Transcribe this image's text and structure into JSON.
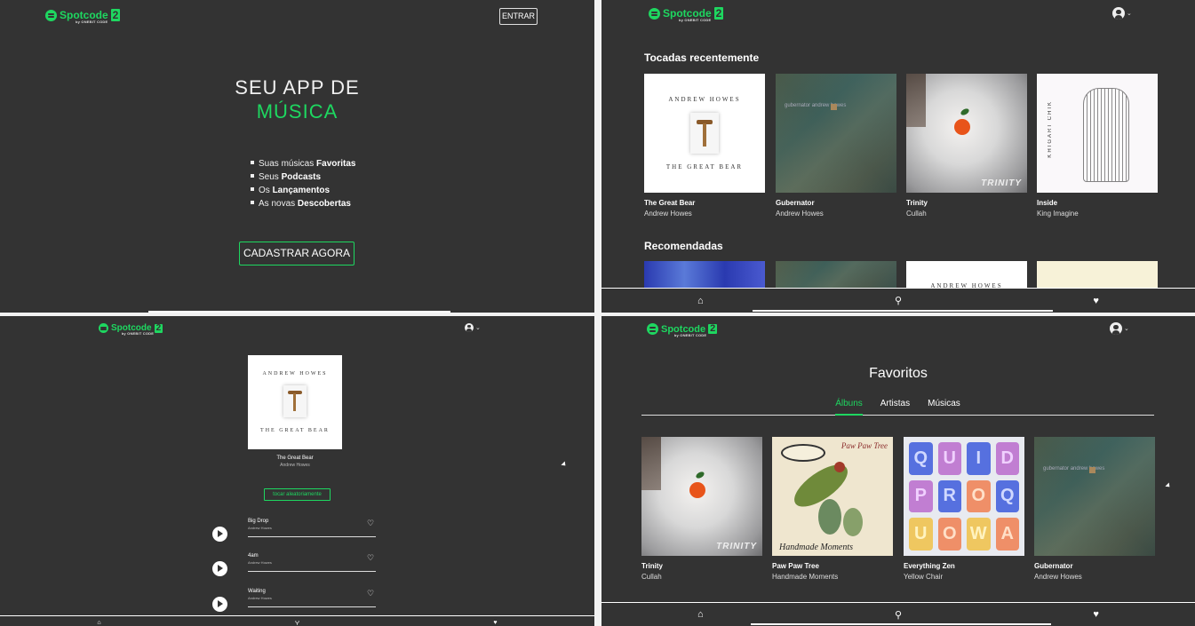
{
  "brand": {
    "name": "Spotcode",
    "version": "2",
    "sub": "by ONEBIT CODE"
  },
  "landing": {
    "login_label": "ENTRAR",
    "hero_line1": "SEU APP DE",
    "hero_line2": "MÚSICA",
    "features": [
      {
        "pre": "Suas músicas ",
        "bold": "Favoritas"
      },
      {
        "pre": "Seus ",
        "bold": "Podcasts"
      },
      {
        "pre": "Os ",
        "bold": "Lançamentos"
      },
      {
        "pre": "As novas ",
        "bold": "Descobertas"
      }
    ],
    "cta_label": "CADASTRAR AGORA"
  },
  "home": {
    "recent_title": "Tocadas recentemente",
    "recommended_title": "Recomendadas",
    "recent": [
      {
        "title": "The Great Bear",
        "artist": "Andrew Howes"
      },
      {
        "title": "Gubernator",
        "artist": "Andrew Howes"
      },
      {
        "title": "Trinity",
        "artist": "Cullah"
      },
      {
        "title": "Inside",
        "artist": "King Imagine"
      }
    ]
  },
  "album": {
    "cover_top": "ANDREW HOWES",
    "cover_bottom": "THE GREAT BEAR",
    "title": "The Great Bear",
    "artist": "Andrew Howes",
    "random_label": "tocar aleatoriamente",
    "tracks": [
      {
        "name": "Big Drop",
        "artist": "Andrew Howes"
      },
      {
        "name": "4am",
        "artist": "Andrew Howes"
      },
      {
        "name": "Waiting",
        "artist": "Andrew Howes"
      }
    ]
  },
  "favorites": {
    "title": "Favoritos",
    "tabs": [
      "Álbuns",
      "Artistas",
      "Músicas"
    ],
    "active_tab": "Álbuns",
    "albums": [
      {
        "title": "Trinity",
        "artist": "Cullah"
      },
      {
        "title": "Paw Paw Tree",
        "artist": "Handmade Moments"
      },
      {
        "title": "Everything Zen",
        "artist": "Yellow Chair"
      },
      {
        "title": "Gubernator",
        "artist": "Andrew Howes"
      }
    ]
  },
  "covers": {
    "bear_top": "ANDREW HOWES",
    "bear_bottom": "THE GREAT BEAR",
    "gub_text": "gubernator andrew howes",
    "trinity_text": "TRINITY",
    "inside_text": "KHIGARI CHIK",
    "paw_title": "Paw Paw Tree",
    "paw_sig": "Handmade Moments",
    "zen_letters": [
      "Q",
      "U",
      "I",
      "D",
      "P",
      "R",
      "O",
      "Q",
      "U",
      "O",
      "W",
      "A"
    ]
  },
  "colors": {
    "accent": "#1ed760",
    "background": "#333333"
  },
  "icons": {
    "home": "home-icon",
    "search": "search-icon",
    "favorites": "heart-icon",
    "user": "user-icon"
  }
}
